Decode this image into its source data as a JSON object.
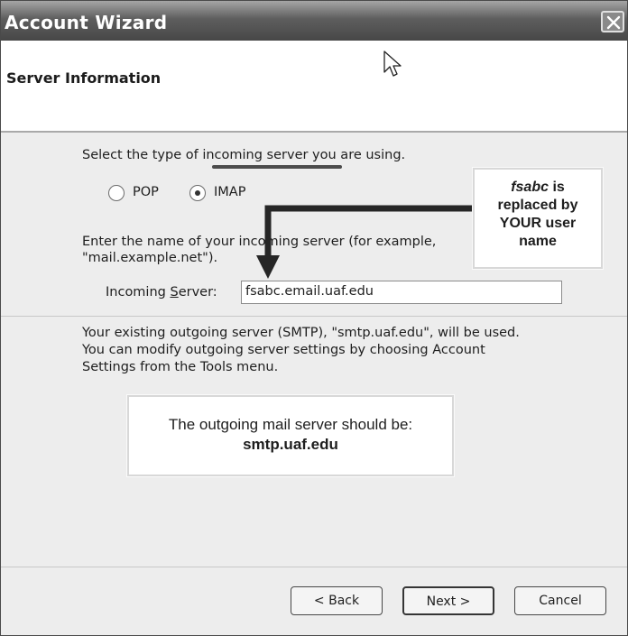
{
  "window": {
    "title": "Account Wizard"
  },
  "header": {
    "title": "Server Information"
  },
  "incoming": {
    "prompt": "Select the type of incoming server you are using.",
    "options": [
      {
        "label": "POP",
        "selected": false
      },
      {
        "label": "IMAP",
        "selected": true
      }
    ],
    "server_prompt_line1": "Enter the name of your incoming server (for example,",
    "server_prompt_line2": "\"mail.example.net\").",
    "server_label": "Incoming Server:",
    "server_label_before": "Incoming ",
    "server_label_mnemonic": "S",
    "server_label_after": "erver:",
    "server_value": "fsabc.email.uaf.edu"
  },
  "outgoing": {
    "line1": "Your existing outgoing server (SMTP), \"smtp.uaf.edu\", will be used.",
    "line2": "You can modify outgoing server settings by choosing Account",
    "line3": "Settings from the Tools menu."
  },
  "callout_user": {
    "emph": "fsabc",
    "line1_rest": " is",
    "line2": "replaced by",
    "line3": "YOUR user",
    "line4": "name"
  },
  "callout_smtp": {
    "line1": "The outgoing mail server should be:",
    "line2": "smtp.uaf.edu"
  },
  "buttons": {
    "back": "< Back",
    "next": "Next >",
    "cancel": "Cancel"
  },
  "colors": {
    "titlebar": "#5e5e5e",
    "background": "#ededed"
  }
}
